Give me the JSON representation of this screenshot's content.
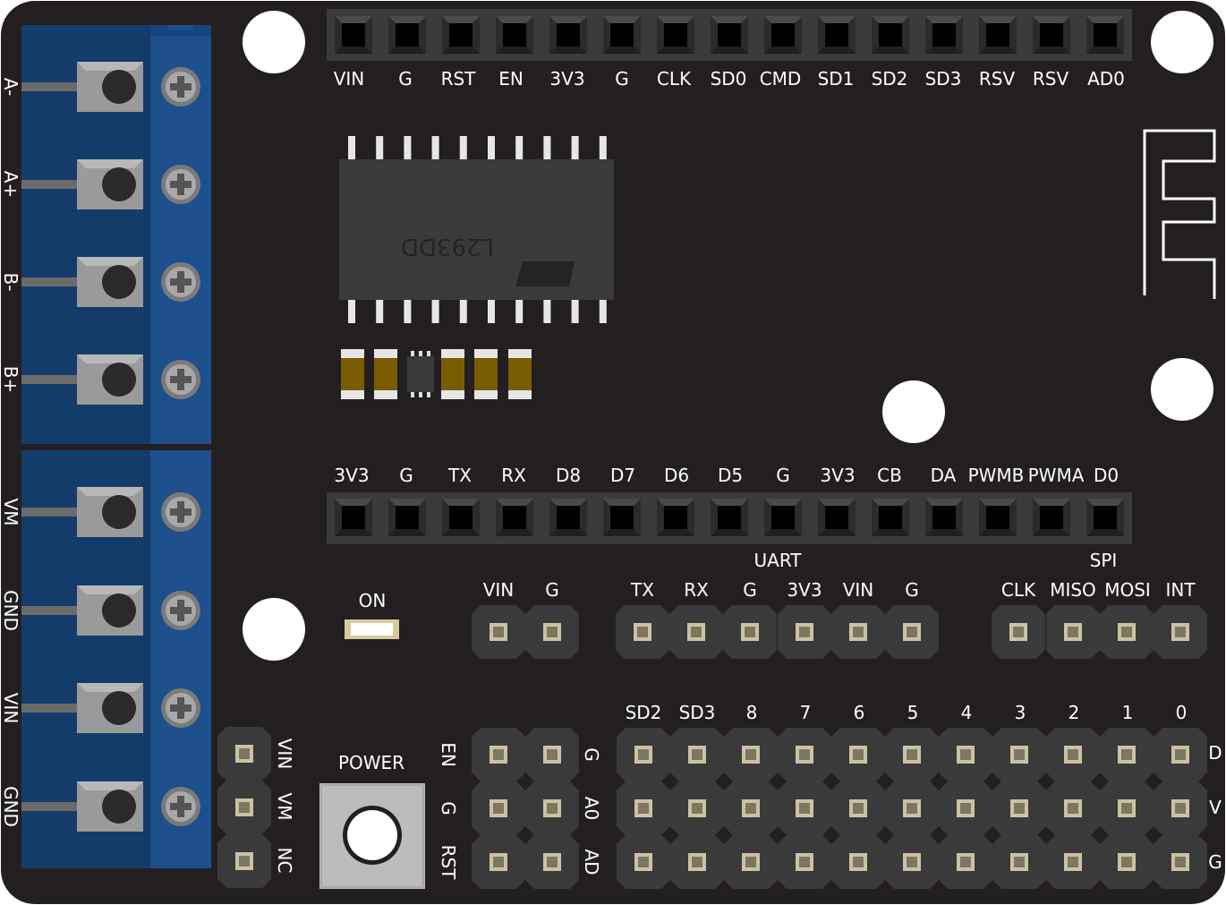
{
  "top_header": {
    "labels": [
      "VIN",
      "G",
      "RST",
      "EN",
      "3V3",
      "G",
      "CLK",
      "SD0",
      "CMD",
      "SD1",
      "SD2",
      "SD3",
      "RSV",
      "RSV",
      "AD0"
    ]
  },
  "chip": {
    "marking": "L293DD"
  },
  "middle_header": {
    "labels": [
      "3V3",
      "G",
      "TX",
      "RX",
      "D8",
      "D7",
      "D6",
      "D5",
      "G",
      "3V3",
      "CB",
      "DA",
      "PWMB",
      "PWMA",
      "D0"
    ]
  },
  "terminals": {
    "upper_labels": [
      "A-",
      "A+",
      "B-",
      "B+"
    ],
    "lower_labels": [
      "VM",
      "GND",
      "VIN",
      "GND"
    ]
  },
  "on_led": {
    "label": "ON"
  },
  "power_header": {
    "labels": [
      "VIN",
      "G"
    ]
  },
  "uart": {
    "title": "UART",
    "labels": [
      "TX",
      "RX",
      "G",
      "3V3",
      "VIN",
      "G"
    ]
  },
  "spi": {
    "title": "SPI",
    "labels": [
      "CLK",
      "MISO",
      "MOSI",
      "INT"
    ]
  },
  "power_select": {
    "labels": [
      "VIN",
      "VM",
      "NC"
    ]
  },
  "power_button": {
    "label": "POWER"
  },
  "small_block": {
    "left_labels": [
      "EN",
      "G",
      "RST"
    ],
    "right_labels": [
      "G",
      "A0",
      "AD"
    ]
  },
  "gpio_grid": {
    "column_labels": [
      "SD2",
      "SD3",
      "8",
      "7",
      "6",
      "5",
      "4",
      "3",
      "2",
      "1",
      "0"
    ],
    "row_labels": [
      "D",
      "V",
      "G"
    ]
  },
  "colors": {
    "board": "#231f20",
    "terminal_blue": "#1c4f8c",
    "terminal_dark_blue": "#143c6a",
    "header": "#3a3a3a",
    "cap_body": "#7a5c00"
  }
}
